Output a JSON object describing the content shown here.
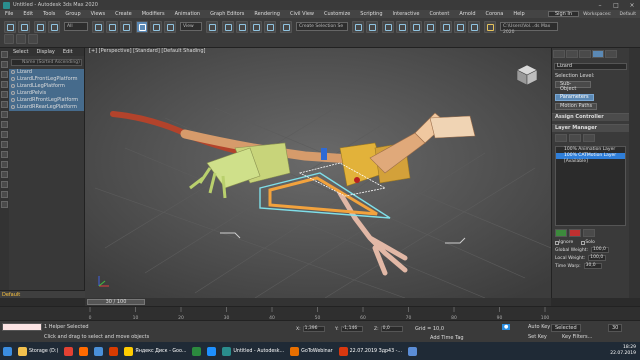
{
  "window": {
    "title": "Untitled - Autodesk 3ds Max 2020"
  },
  "menubar": {
    "items": [
      "File",
      "Edit",
      "Tools",
      "Group",
      "Views",
      "Create",
      "Modifiers",
      "Animation",
      "Graph Editors",
      "Rendering",
      "Civil View",
      "Customize",
      "Scripting",
      "Interactive",
      "Content",
      "Arnold",
      "Corona",
      "Help"
    ],
    "sign_in": "Sign In",
    "workspaces_label": "Workspaces:",
    "workspaces_value": "Default"
  },
  "toolbar": {
    "filter_value": "All",
    "view_value": "View",
    "selection_set": "Create Selection Se",
    "path": "C:\\Users\\Vol...ds Max 2020"
  },
  "scene_explorer": {
    "tabs": [
      "Select",
      "Display",
      "Edit"
    ],
    "search_text": "Name (Sorted Ascending)",
    "rows": [
      {
        "name": "Lizard",
        "selected": true
      },
      {
        "name": "LizardLFrontLegPlatform",
        "selected": true
      },
      {
        "name": "LizardLLegPlatform",
        "selected": true
      },
      {
        "name": "LizardPelvis",
        "selected": true
      },
      {
        "name": "LizardRFrontLegPlatform",
        "selected": true
      },
      {
        "name": "LizardRRearLegPlatform",
        "selected": true
      }
    ]
  },
  "viewport": {
    "label": "[+] [Perspective] [Standard] [Default Shading]"
  },
  "command_panel": {
    "object_name": "Lizard",
    "selection_level_label": "Selection Level:",
    "selection_level_value": "Sub-Object",
    "parameters_btn": "Parameters",
    "motion_paths_btn": "Motion Paths",
    "assign_controller": "Assign Controller",
    "layer_manager": "Layer Manager",
    "layers": [
      "100% Animation Layer",
      "100% CATMotion Layer",
      "[Available]"
    ],
    "ignore_label": "Ignore",
    "solo_label": "Solo",
    "global_weight_label": "Global Weight:",
    "global_weight_value": "100,0",
    "local_weight_label": "Local Weight:",
    "local_weight_value": "100,0",
    "time_warp_label": "Time Warp:",
    "time_warp_value": "30,0"
  },
  "status": {
    "layer": "Default",
    "frame_counter": "30 / 100",
    "selected": "1 Helper Selected",
    "hint": "Click and drag to select and move objects",
    "x_label": "X:",
    "x_value": "1,396",
    "y_label": "Y:",
    "y_value": "-1,146",
    "z_label": "Z:",
    "z_value": "0,0",
    "grid": "Grid = 10,0",
    "add_time_tag": "Add Time Tag",
    "auto_key": "Auto Key",
    "selected_label": "Selected",
    "set_key": "Set Key",
    "key_filters": "Key Filters...",
    "current_frame": "30"
  },
  "track_ticks": [
    "0",
    "10",
    "20",
    "30",
    "40",
    "50",
    "60",
    "70",
    "80",
    "90",
    "100"
  ],
  "taskbar": {
    "items": [
      {
        "label": "Storage (D:)",
        "color": "#f2c14e"
      },
      {
        "label": "",
        "color": "#e34133"
      },
      {
        "label": "",
        "color": "#ff6a00"
      },
      {
        "label": "",
        "color": "#4a90d9"
      },
      {
        "label": "",
        "color": "#d83b01"
      },
      {
        "label": "Яндекс Диск - Goo...",
        "color": "#ffcc00"
      },
      {
        "label": "",
        "color": "#2b8a3e"
      },
      {
        "label": "",
        "color": "#1e90ff"
      },
      {
        "label": "Untitled - Autodesk...",
        "color": "#2a8d8d"
      },
      {
        "label": "GoToWebinar",
        "color": "#e86f00"
      },
      {
        "label": "22.07.2019 Здр43 -...",
        "color": "#d9380f"
      },
      {
        "label": "",
        "color": "#5b8dd6"
      }
    ],
    "time": "18:29",
    "date": "22.07.2019"
  }
}
